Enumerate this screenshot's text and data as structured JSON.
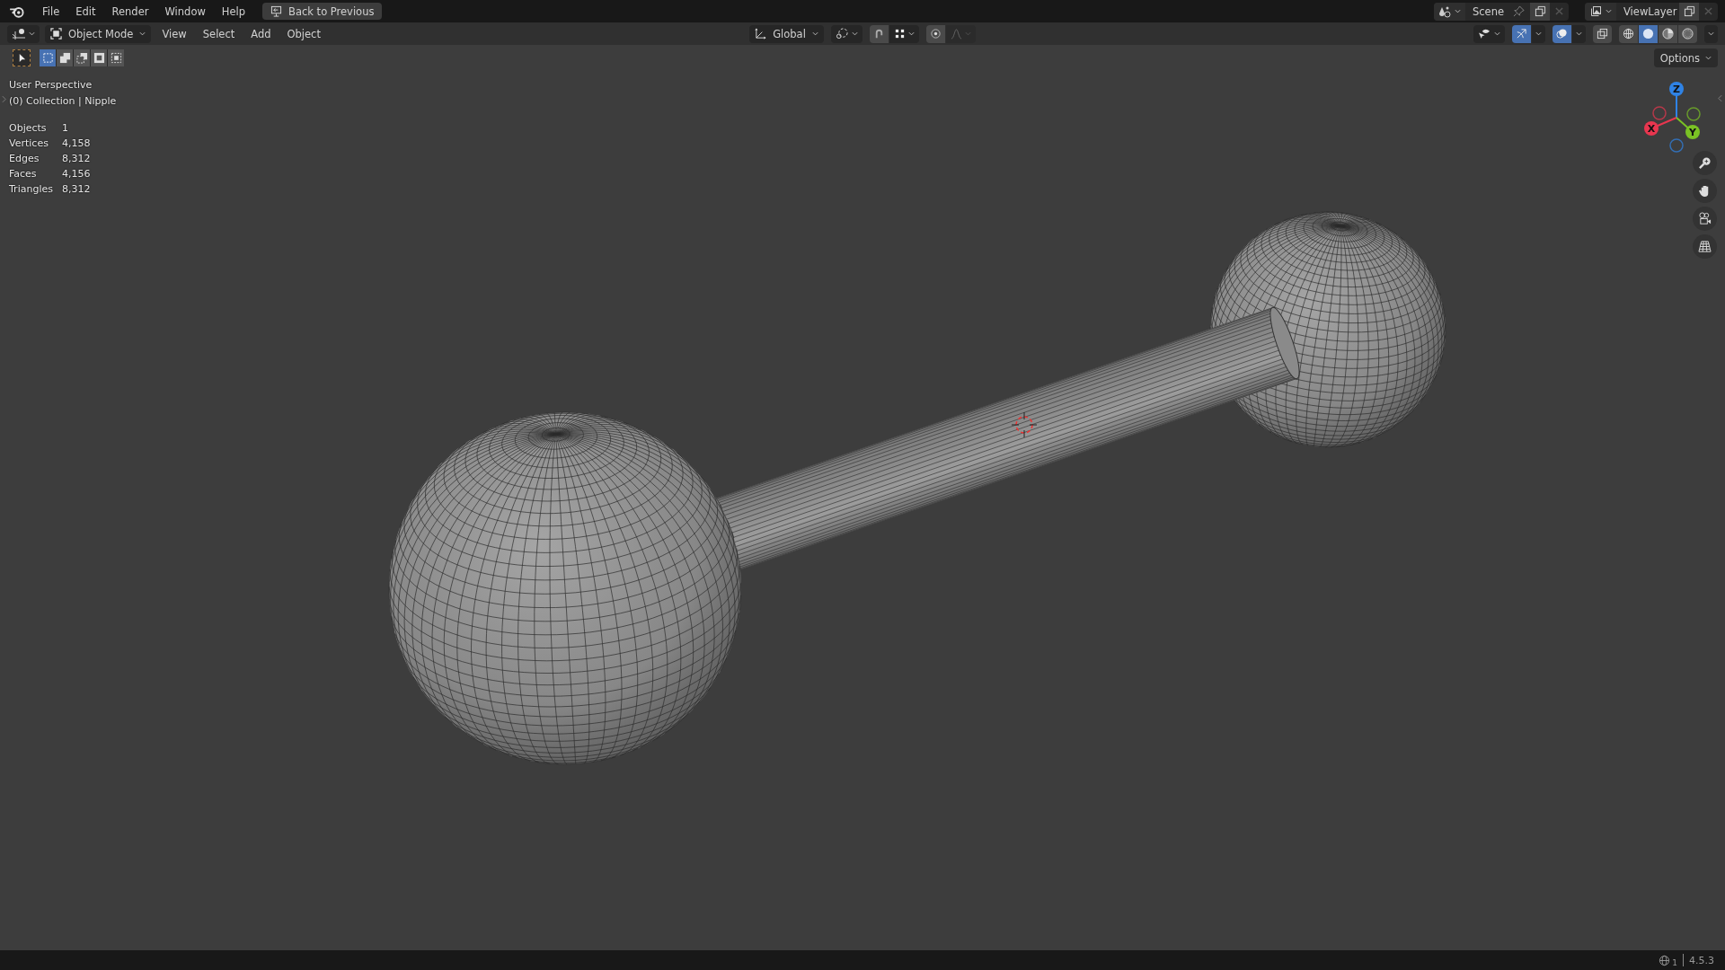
{
  "top_bar": {
    "menus": [
      "File",
      "Edit",
      "Render",
      "Window",
      "Help"
    ],
    "back_button": "Back to Previous",
    "scene": "Scene",
    "view_layer": "ViewLayer"
  },
  "header": {
    "mode": "Object Mode",
    "menus": [
      "View",
      "Select",
      "Add",
      "Object"
    ],
    "orientation": "Global",
    "gizmos_on": true,
    "overlays_on": true,
    "xray_on": false,
    "shading": [
      {
        "kind": "wireframe",
        "selected": false
      },
      {
        "kind": "solid",
        "selected": true
      },
      {
        "kind": "material",
        "selected": false
      },
      {
        "kind": "rendered",
        "selected": false
      }
    ]
  },
  "tool_settings": {
    "select_modes": [
      {
        "kind": "new",
        "selected": true
      },
      {
        "kind": "extend",
        "selected": false
      },
      {
        "kind": "subtract",
        "selected": false
      },
      {
        "kind": "invert",
        "selected": false
      },
      {
        "kind": "intersect",
        "selected": false
      }
    ],
    "options": "Options"
  },
  "viewport": {
    "view_name": "User Perspective",
    "collection": "(0) Collection | Nipple",
    "stats": [
      {
        "label": "Objects",
        "value": "1"
      },
      {
        "label": "Vertices",
        "value": "4,158"
      },
      {
        "label": "Edges",
        "value": "8,312"
      },
      {
        "label": "Faces",
        "value": "4,156"
      },
      {
        "label": "Triangles",
        "value": "8,312"
      }
    ],
    "axes": [
      {
        "label": "Z",
        "color": "#2f83e6"
      },
      {
        "label": "X",
        "color": "#e8364f"
      },
      {
        "label": "Y",
        "color": "#7ac224"
      }
    ]
  },
  "status_bar": {
    "scene_count": "1",
    "version": "4.5.3"
  }
}
